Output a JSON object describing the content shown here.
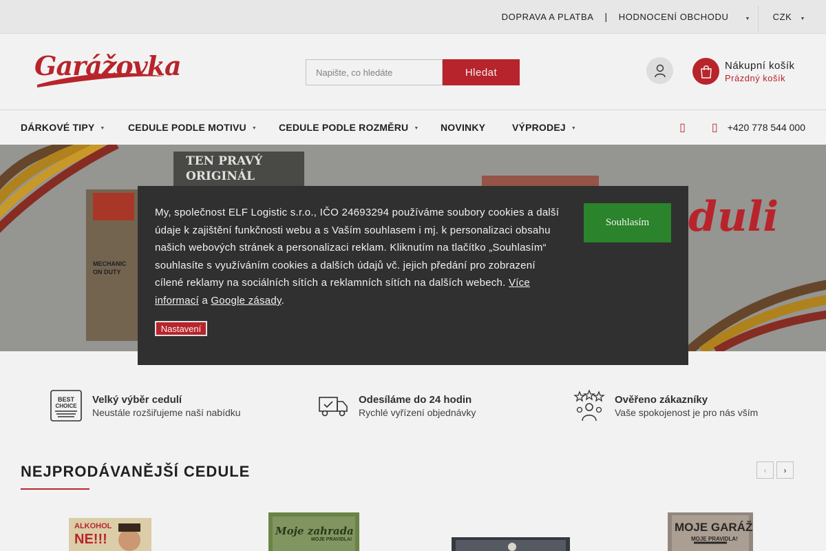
{
  "topbar": {
    "links": [
      "DOPRAVA A PLATBA",
      "HODNOCENÍ OBCHODU"
    ],
    "separator": "|",
    "currency": "CZK"
  },
  "header": {
    "logo": "Garážovka",
    "search": {
      "placeholder": "Napište, co hledáte",
      "button": "Hledat"
    },
    "cart": {
      "title": "Nákupní košík",
      "status": "Prázdný košík"
    }
  },
  "nav": {
    "items": [
      {
        "label": "DÁRKOVÉ TIPY"
      },
      {
        "label": "CEDULE PODLE MOTIVU"
      },
      {
        "label": "CEDULE PODLE ROZMĚRU"
      },
      {
        "label": "NOVINKY"
      },
      {
        "label": "VÝPRODEJ"
      }
    ],
    "phone": "+420 778 544 000"
  },
  "hero": {
    "sign_text_1": "TEN PRAVÝ",
    "sign_text_2": "ORIGINÁL",
    "sign_text_3": "MECHANIC",
    "sign_text_4": "ON DUTY",
    "big_text": "duli"
  },
  "cookie": {
    "text_main": "My, společnost ELF Logistic s.r.o., IČO 24693294 používáme soubory cookies a další údaje k zajištění funkčnosti webu a s Vaším souhlasem i mj. k personalizaci obsahu našich webových stránek a personalizaci reklam. Kliknutím na tlačítko „Souhlasím“ souhlasíte s využíváním cookies a dalších údajů vč. jejich předání pro zobrazení cílené reklamy na sociálních sítích a reklamních sítích na dalších webech.",
    "more_info": "Více informací",
    "and": "a",
    "google": "Google zásady",
    "period": ".",
    "accept": "Souhlasím",
    "settings": "Nastavení"
  },
  "features": [
    {
      "title": "Velký výběr cedulí",
      "subtitle": "Neustále rozšiřujeme naší nabídku",
      "icon": "best-choice-icon",
      "icon_text_1": "BEST",
      "icon_text_2": "CHOICE"
    },
    {
      "title": "Odesíláme do 24 hodin",
      "subtitle": "Rychlé vyřízení objednávky",
      "icon": "delivery-truck-icon"
    },
    {
      "title": "Ověřeno zákazníky",
      "subtitle": "Vaše spokojenost je pro nás vším",
      "icon": "customers-stars-icon"
    }
  ],
  "bestsellers": {
    "title": "NEJPRODÁVANĚJŠÍ CEDULE",
    "products": [
      {
        "line1": "ALKOHOL",
        "line2": "NE!!!"
      },
      {
        "line1": "Moje zahrada",
        "line2": "MOJE PRAVIDLA!"
      },
      {
        "line1": ""
      },
      {
        "line1": "MOJE GARÁŽ",
        "line2": "MOJE PRAVIDLA!"
      }
    ]
  },
  "colors": {
    "brand_red": "#c2262e",
    "accept_green": "#2e8b2e",
    "cookie_bg": "#333333"
  }
}
